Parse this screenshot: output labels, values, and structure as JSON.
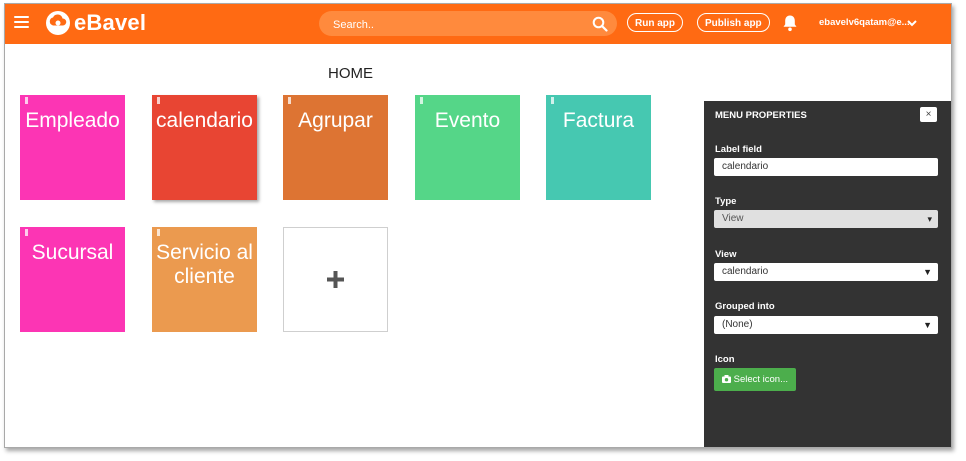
{
  "app": {
    "name": "eBavel"
  },
  "header": {
    "search_placeholder": "Search..",
    "run_app_label": "Run app",
    "publish_app_label": "Publish app",
    "user_label": "ebavelv6qatam@e..."
  },
  "page": {
    "title": "HOME"
  },
  "tiles": [
    {
      "label": "Empleado",
      "color": "#fc35b4"
    },
    {
      "label": "calendario",
      "color": "#e84533"
    },
    {
      "label": "Agrupar",
      "color": "#dd7433"
    },
    {
      "label": "Evento",
      "color": "#55d688"
    },
    {
      "label": "Factura",
      "color": "#46c8b1"
    },
    {
      "label": "Sucursal",
      "color": "#fc35b4"
    },
    {
      "label": "Servicio al cliente",
      "color": "#eb9a4f"
    }
  ],
  "panel": {
    "title": "MENU PROPERTIES",
    "close_label": "×",
    "label_field_label": "Label field",
    "label_field_value": "calendario",
    "type_label": "Type",
    "type_value": "View",
    "view_label": "View",
    "view_value": "calendario",
    "grouped_label": "Grouped into",
    "grouped_value": "(None)",
    "icon_label": "Icon",
    "select_icon_label": "Select icon..."
  },
  "colors": {
    "brand": "#ff6a13",
    "panel_bg": "#333333",
    "select_icon_green": "#4cae4c"
  }
}
